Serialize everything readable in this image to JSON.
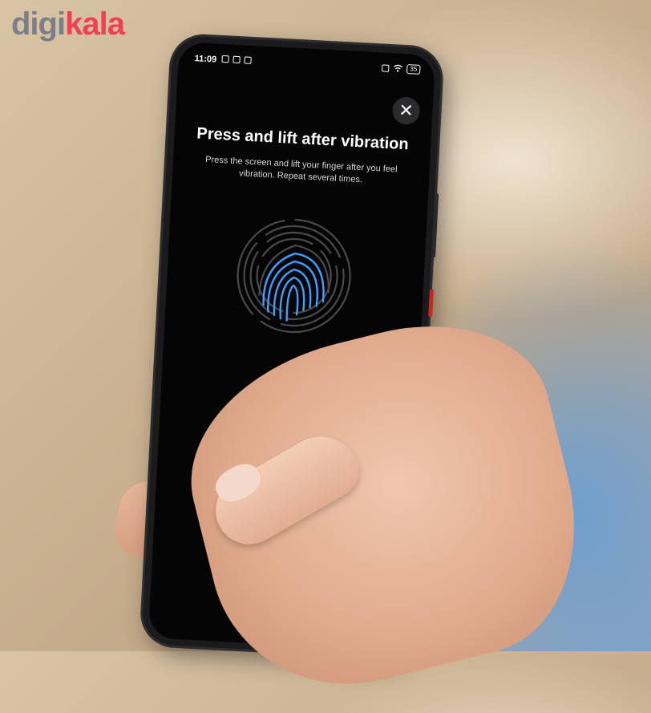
{
  "brand": {
    "part1": "digi",
    "part2": "kala"
  },
  "status_bar": {
    "time": "11:09",
    "battery": "35"
  },
  "screen": {
    "close_label": "✕",
    "title": "Press and lift after vibration",
    "subtitle": "Press the screen and lift your finger after you feel vibration. Repeat several times.",
    "scanner_label": "Fingerprint scanner"
  },
  "icons": [
    "close-icon",
    "fingerprint-icon",
    "wifi-icon",
    "battery-icon",
    "alarm-icon"
  ],
  "colors": {
    "brand_red": "#ef4056",
    "brand_gray": "#7b7f86",
    "fingerprint_blue": "#3ba0ff",
    "fingerprint_gray": "#4a4a4e"
  }
}
